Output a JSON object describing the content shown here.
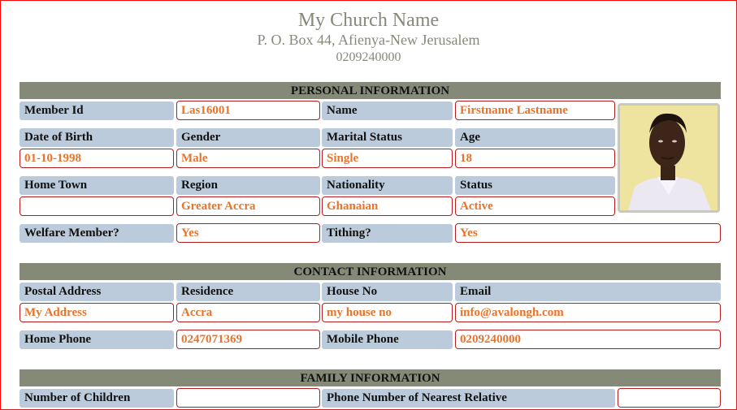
{
  "header": {
    "church_name": "My Church Name",
    "address": "P. O. Box 44, Afienya-New Jerusalem",
    "phone": "0209240000"
  },
  "personal": {
    "title": "PERSONAL INFORMATION",
    "member_id": {
      "label": "Member Id",
      "value": "Las16001"
    },
    "name": {
      "label": "Name",
      "value": "Firstname Lastname"
    },
    "dob": {
      "label": "Date of Birth",
      "value": "01-10-1998"
    },
    "gender": {
      "label": "Gender",
      "value": "Male"
    },
    "marital_status": {
      "label": "Marital Status",
      "value": "Single"
    },
    "age": {
      "label": "Age",
      "value": "18"
    },
    "home_town": {
      "label": "Home Town",
      "value": ""
    },
    "region": {
      "label": "Region",
      "value": "Greater Accra"
    },
    "nationality": {
      "label": "Nationality",
      "value": "Ghanaian"
    },
    "status": {
      "label": "Status",
      "value": "Active"
    },
    "welfare": {
      "label": "Welfare Member?",
      "value": "Yes"
    },
    "tithing": {
      "label": "Tithing?",
      "value": "Yes"
    },
    "photo_alt": "member-photo"
  },
  "contact": {
    "title": "CONTACT INFORMATION",
    "postal_address": {
      "label": "Postal Address",
      "value": "My Address"
    },
    "residence": {
      "label": "Residence",
      "value": "Accra"
    },
    "house_no": {
      "label": "House No",
      "value": "my house no"
    },
    "email": {
      "label": "Email",
      "value": "info@avalongh.com"
    },
    "home_phone": {
      "label": "Home Phone",
      "value": "0247071369"
    },
    "mobile_phone": {
      "label": "Mobile Phone",
      "value": "0209240000"
    }
  },
  "family": {
    "title": "FAMILY INFORMATION",
    "num_children": {
      "label": "Number of Children",
      "value": ""
    },
    "relative_phone": {
      "label": "Phone Number of Nearest Relative",
      "value": ""
    }
  }
}
